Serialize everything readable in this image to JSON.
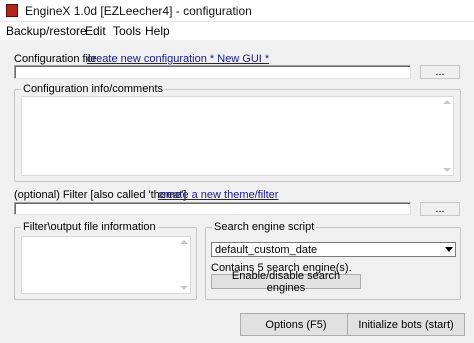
{
  "window": {
    "title": "EngineX 1.0d [EZLeecher4] - configuration"
  },
  "menu": {
    "items": [
      {
        "label": "Backup/restore"
      },
      {
        "label": "Edit"
      },
      {
        "label": "Tools"
      },
      {
        "label": "Help"
      }
    ]
  },
  "config_file": {
    "label": "Configuration file",
    "link": "create new configuration  * New GUI *",
    "value": "",
    "browse_label": "..."
  },
  "config_info": {
    "title": "Configuration info/comments",
    "value": ""
  },
  "filter": {
    "label": "(optional) Filter [also called 'theme']",
    "link": "create a new theme/filter",
    "value": "",
    "browse_label": "..."
  },
  "filter_output": {
    "title": "Filter\\output file information",
    "value": ""
  },
  "search_engine": {
    "title": "Search engine script",
    "selected": "default_custom_date",
    "status": "Contains 5 search engine(s).",
    "toggle_label": "Enable/disable search engines"
  },
  "footer": {
    "options_label": "Options (F5)",
    "init_label": "Initialize bots (start)"
  },
  "colors": {
    "link": "#1a1a8a",
    "app_icon": "#b3261e",
    "background": "#f0f0f0"
  }
}
